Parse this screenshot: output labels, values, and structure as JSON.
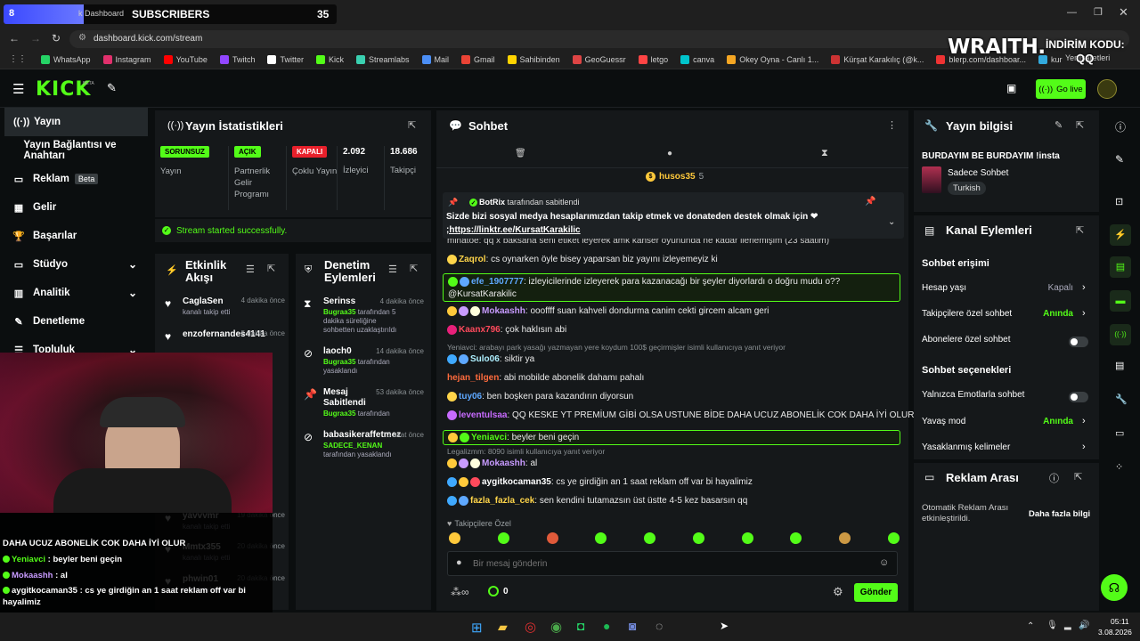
{
  "browser": {
    "subs_count_left": "8",
    "subs_label": "SUBSCRIBERS",
    "subs_count_right": "35",
    "tab_partial": "k Dashboard",
    "url": "dashboard.kick.com/stream",
    "bookmarks": [
      "WhatsApp",
      "Instagram",
      "YouTube",
      "Twitch",
      "Twitter",
      "Kick",
      "Streamlabs",
      "Mail",
      "Gmail",
      "Sahibinden",
      "GeoGuessr",
      "letgo",
      "canva",
      "Okey Oyna - Canlı 1...",
      "Kürşat Karakılıç (@k...",
      "blerp.com/dashboar...",
      "kur"
    ],
    "bookmarks_right": "Yer İşaretleri"
  },
  "overlay": {
    "brand": "WRAITH.",
    "discount_label": "İNDİRİM KODU:",
    "code": "QQ"
  },
  "top": {
    "logo": "KICK",
    "beta": "BETA",
    "go_live": "Go live"
  },
  "nav": [
    {
      "label": "Yayın",
      "icon": "((·))"
    },
    {
      "label": "Yayın Bağlantısı ve Anahtarı",
      "icon": ""
    },
    {
      "label": "Reklam",
      "icon": "▭",
      "badge": "Beta"
    },
    {
      "label": "Gelir",
      "icon": "▦"
    },
    {
      "label": "Başarılar",
      "icon": "🏆"
    },
    {
      "label": "Stüdyo",
      "icon": "▭",
      "chev": "⌄"
    },
    {
      "label": "Analitik",
      "icon": "▥",
      "chev": "⌄"
    },
    {
      "label": "Denetleme",
      "icon": "✎"
    },
    {
      "label": "Topluluk",
      "icon": "☰",
      "chev": "⌄"
    }
  ],
  "stats": {
    "title": "Yayın İstatistikleri",
    "cols": [
      {
        "tag": "SORUNSUZ",
        "label": "Yayın"
      },
      {
        "tag": "AÇIK",
        "label": "Partnerlik Gelir Programı"
      },
      {
        "tag": "KAPALI",
        "label": "Çoklu Yayın"
      },
      {
        "tag": "2.092",
        "label": "İzleyici"
      },
      {
        "tag": "18.686",
        "label": "Takipçi"
      }
    ],
    "status": "Stream started successfully."
  },
  "activity": {
    "title": "Etkinlik Akışı",
    "items": [
      {
        "name": "CaglaSen",
        "time": "4 dakika önce",
        "desc": "kanalı takip etti"
      },
      {
        "name": "enzofernandes4141",
        "time": "5 dakika önce",
        "desc": ""
      },
      {
        "name": "yavvvmr",
        "time": "19 dakika önce",
        "desc": "kanalı takip etti"
      },
      {
        "name": "Mmtx355",
        "time": "20 dakika önce",
        "desc": "kanalı takip etti"
      },
      {
        "name": "phwin01",
        "time": "20 dakika önce",
        "desc": "kanalı takip etti"
      }
    ],
    "partial_times": [
      "5",
      "ce",
      "ce",
      "ce",
      "itka",
      "ce"
    ]
  },
  "moderation": {
    "title": "Denetim Eylemleri",
    "items": [
      {
        "name": "Serinss",
        "time": "4 dakika önce",
        "by": "Bugraa35",
        "desc": " tarafından 5 dakika süreliğine sohbetten uzaklaştırıldı"
      },
      {
        "name": "laoch0",
        "time": "14 dakika önce",
        "by": "Bugraa35",
        "desc": " tarafından yasaklandı"
      },
      {
        "name": "Mesaj Sabitlendi",
        "time": "53 dakika önce",
        "by": "Bugraa35",
        "desc": " tarafından"
      },
      {
        "name": "babasikeraffetmez",
        "time": "3 saat önce",
        "by": "SADECE_KENAN",
        "desc": " tarafından yasaklandı"
      }
    ]
  },
  "chat": {
    "title": "Sohbet",
    "top_user": "husos35",
    "top_count": "5",
    "pinned": {
      "by": "BotRix",
      "by_suffix": " tarafından sabitlendi",
      "text": "Sizde bizi sosyal medya hesaplarımızdan takip etmek ve donateden destek olmak için ❤",
      "link": ";https://linktr.ee/KursatKarakilic"
    },
    "cut_line": "minatoe: qq x baksana seni etiket leyerek amk kanser oyununda ne kadar ilerlemişim (23 saatim)",
    "messages": [
      {
        "user": "Zaqrol",
        "color": "#ffd54a",
        "text": " cs oynarken öyle bisey yaparsan biz yayını izleyemeyiz ki",
        "reply": ""
      },
      {
        "user": "efe_1907777",
        "color": "#5ea8ff",
        "text": " izleyicilerinde izleyerek para kazanacağı bir şeyler diyorlardı o doğru mudu o?? @KursatKarakilic",
        "reply": ""
      },
      {
        "user": "Mokaashh",
        "color": "#c89bff",
        "text": " oooffff suan kahveli dondurma canim cekti gircem alcam geri",
        "reply": ""
      },
      {
        "user": "Kaanx796",
        "color": "#ff4a5c",
        "text": " çok haklısın abi",
        "reply": ""
      },
      {
        "user": "Sulo06",
        "color": "#aef0ff",
        "text": " siktir ya",
        "reply": "Yeniavci: arabayı park yasağı yazmayan yere koydum 100$ geçirmişler isimli kullanıcıya yanıt veriyor"
      },
      {
        "user": "hejan_tilgen",
        "color": "#ff6b3d",
        "text": " abi mobilde abonelik dahamı pahalı",
        "reply": ""
      },
      {
        "user": "tuy06",
        "color": "#5ea8ff",
        "text": " ben boşken para kazandırın diyorsun",
        "reply": ""
      },
      {
        "user": "leventulsaa",
        "color": "#c86bff",
        "text": " QQ KESKE YT PREMİUM GİBİ OLSA USTUNE BİDE DAHA UCUZ ABONELİK COK DAHA İYİ OLUR",
        "reply": ""
      },
      {
        "user": "Yeniavci",
        "color": "#53fc18",
        "text": " beyler beni geçin",
        "reply": ""
      },
      {
        "user": "Mokaashh",
        "color": "#c89bff",
        "text": " al",
        "reply": "Legalizmm: 8090 isimli kullanıcıya yanıt veriyor"
      },
      {
        "user": "aygitkocaman35",
        "color": "#ffffff",
        "text": " cs ye girdiğin an 1 saat reklam off var bi hayalimiz",
        "reply": ""
      },
      {
        "user": "fazla_fazla_cek",
        "color": "#ffd54a",
        "text": " sen kendini tutamazsın üst üstte 4-5 kez basarsın qq",
        "reply": ""
      }
    ],
    "follower_only": "Takipçilere Özel",
    "placeholder": "Bir mesaj gönderin",
    "points": "0",
    "send": "Gönder"
  },
  "info": {
    "title": "Yayın bilgisi",
    "stream_title": "BURDAYIM BE BURDAYIM !insta",
    "category": "Sadece Sohbet",
    "language": "Turkish"
  },
  "channel": {
    "title": "Kanal Eylemleri",
    "access": "Sohbet erişimi",
    "rows": [
      {
        "label": "Hesap yaşı",
        "value": "Kapalı"
      },
      {
        "label": "Takipçilere özel sohbet",
        "value": "Anında"
      },
      {
        "label": "Abonelere özel sohbet",
        "value": ""
      }
    ],
    "options": "Sohbet seçenekleri",
    "rows2": [
      {
        "label": "Yalnızca Emotlarla sohbet",
        "value": ""
      },
      {
        "label": "Yavaş mod",
        "value": "Anında"
      },
      {
        "label": "Yasaklanmış kelimeler",
        "value": ""
      }
    ]
  },
  "ads": {
    "title": "Reklam Arası",
    "text": "Otomatik Reklam Arası etkinleştirildi.",
    "link": "Daha fazla bilgi"
  },
  "webcam_chat": [
    {
      "user": "",
      "text": "DAHA UCUZ ABONELİK COK DAHA İYİ OLUR"
    },
    {
      "user": "Yeniavci",
      "text": " : beyler beni geçin"
    },
    {
      "user": "Mokaashh",
      "text": " : al"
    },
    {
      "user": "aygitkocaman35",
      "text": " : cs ye girdiğin an 1 saat reklam off var bi hayalimiz"
    },
    {
      "user": "fazla_fazla_cek",
      "text": " : sen kendini tutamazsın üst üstte 4-5 kez basarsın qq"
    }
  ],
  "taskbar": {
    "time": "05:11",
    "date": "3.08.2026"
  }
}
